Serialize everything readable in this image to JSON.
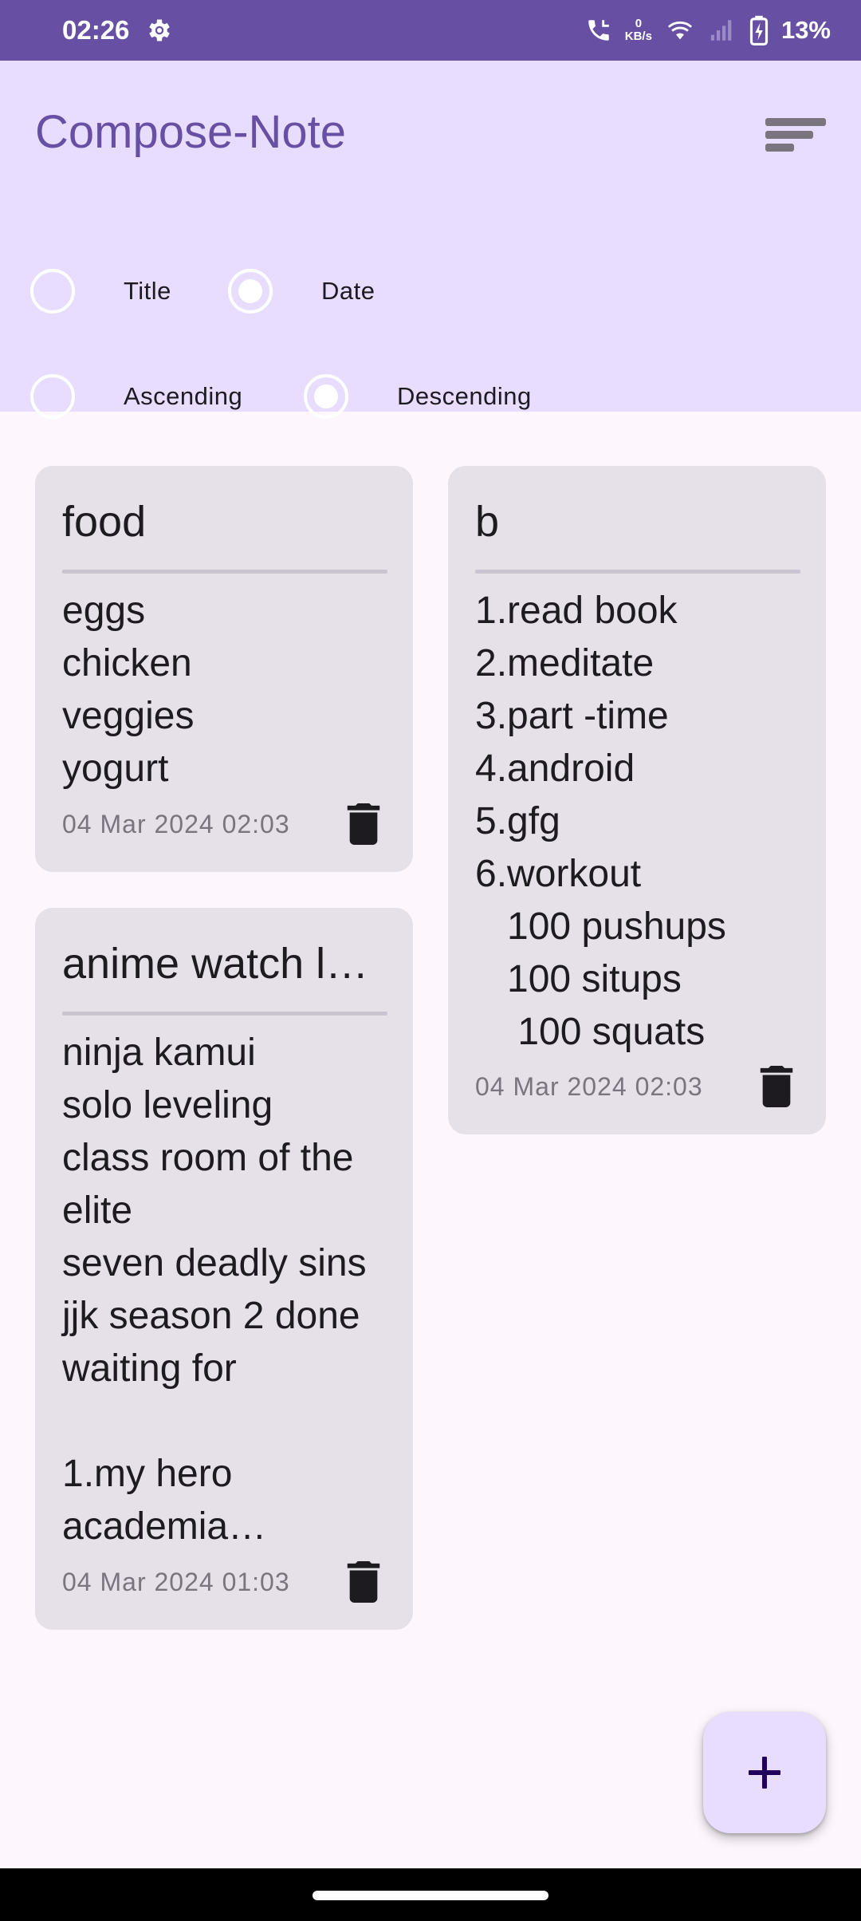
{
  "status_bar": {
    "time": "02:26",
    "net_speed_value": "0",
    "net_speed_unit": "KB/s",
    "battery": "13%"
  },
  "header": {
    "title": "Compose-Note",
    "sort_by": [
      {
        "label": "Title",
        "selected": false
      },
      {
        "label": "Date",
        "selected": true
      }
    ],
    "order": [
      {
        "label": "Ascending",
        "selected": false
      },
      {
        "label": "Descending",
        "selected": true
      }
    ]
  },
  "notes": [
    {
      "title": "food",
      "content": "eggs\nchicken\nveggies\nyogurt",
      "date": "04 Mar 2024 02:03"
    },
    {
      "title": "b",
      "content": "1.read book\n2.meditate\n3.part -time\n4.android\n5.gfg\n6.workout\n   100 pushups\n   100 situps\n    100 squats",
      "date": "04 Mar 2024 02:03"
    },
    {
      "title": "anime watch l…",
      "content": "ninja kamui\nsolo leveling\nclass room of the\nelite\nseven deadly sins\njjk season 2 done\nwaiting for\n\n1.my hero\nacademia…",
      "date": "04 Mar 2024 01:03"
    }
  ],
  "colors": {
    "primary": "#6750a4",
    "header_bg": "#e9ddff",
    "card_bg": "#e6e0e9"
  }
}
